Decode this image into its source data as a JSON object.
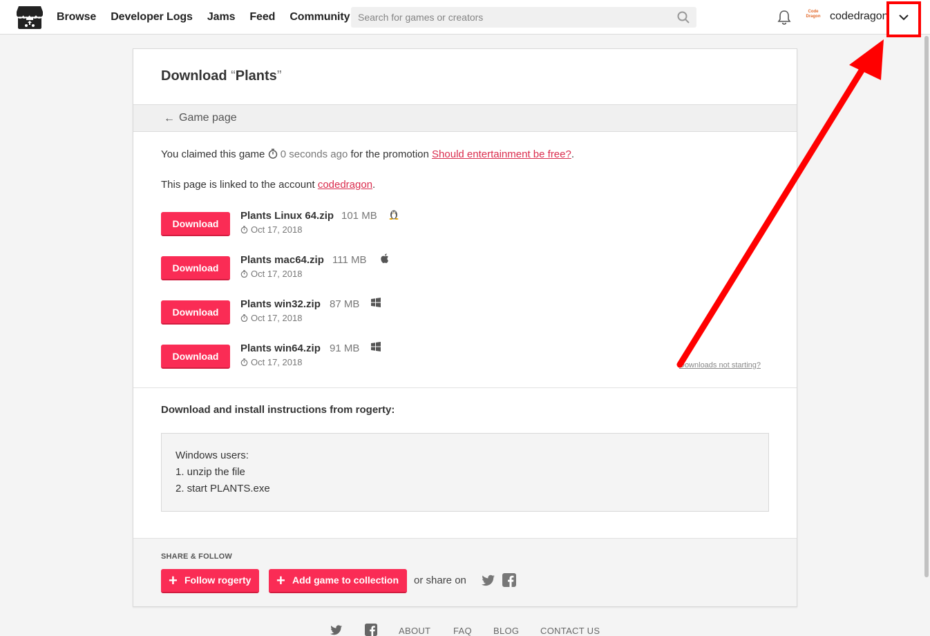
{
  "header": {
    "nav": [
      "Browse",
      "Developer Logs",
      "Jams",
      "Feed",
      "Community"
    ],
    "search_placeholder": "Search for games or creators",
    "username": "codedragon",
    "avatar_text": "Code Dragon"
  },
  "page": {
    "title_prefix": "Download ",
    "open_quote": "“",
    "game_name": "Plants",
    "close_quote": "”",
    "back_arrow": "←",
    "back_label": "Game page",
    "claim_prefix": "You claimed this game ",
    "claim_time": "0 seconds ago",
    "claim_mid": " for the promotion ",
    "claim_link": "Should entertainment be free?",
    "claim_suffix": ".",
    "linked_prefix": "This page is linked to the account ",
    "linked_account": "codedragon",
    "linked_suffix": ".",
    "download_label": "Download",
    "uploads": [
      {
        "name": "Plants Linux 64.zip",
        "size": "101 MB",
        "platform": "linux-icon",
        "date": "Oct 17, 2018"
      },
      {
        "name": "Plants mac64.zip",
        "size": "111 MB",
        "platform": "apple-icon",
        "date": "Oct 17, 2018"
      },
      {
        "name": "Plants win32.zip",
        "size": "87 MB",
        "platform": "windows-icon",
        "date": "Oct 17, 2018"
      },
      {
        "name": "Plants win64.zip",
        "size": "91 MB",
        "platform": "windows-icon",
        "date": "Oct 17, 2018"
      }
    ],
    "not_starting": "Downloads not starting?",
    "instructions_title": "Download and install instructions from rogerty:",
    "instructions_lines": [
      "Windows users:",
      "1. unzip the file",
      "2. start PLANTS.exe"
    ]
  },
  "share": {
    "title": "SHARE & FOLLOW",
    "follow_label": "Follow rogerty",
    "collection_label": "Add game to collection",
    "or_share": "or share on"
  },
  "footer": {
    "links": [
      "ABOUT",
      "FAQ",
      "BLOG",
      "CONTACT US"
    ]
  },
  "colors": {
    "accent": "#fa2c55",
    "link": "#da2c4d",
    "annotation": "#ff0000"
  }
}
